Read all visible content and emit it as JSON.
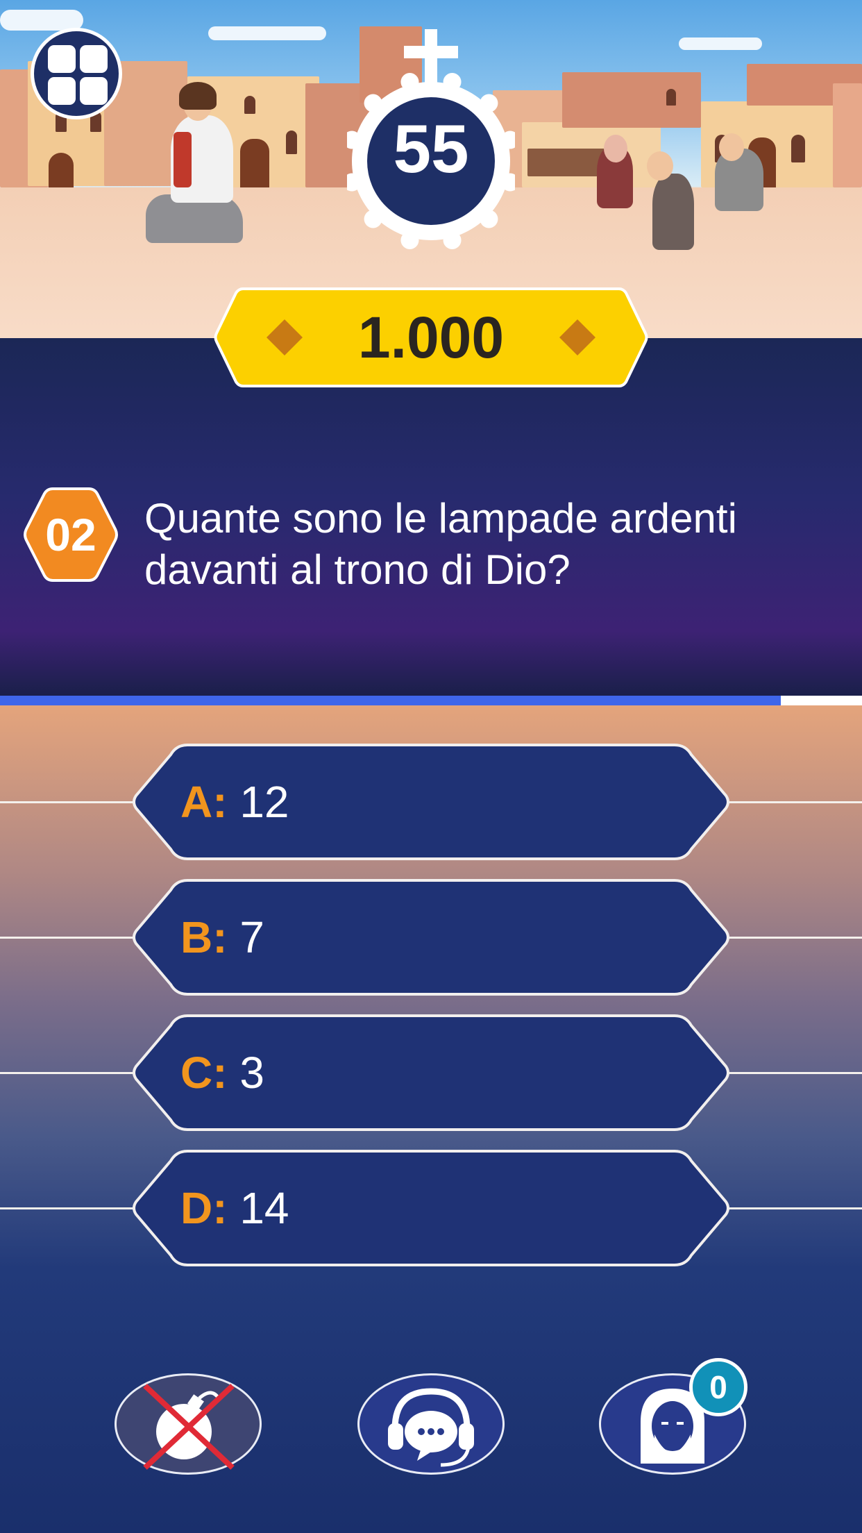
{
  "timer": {
    "seconds": "55"
  },
  "prize": {
    "amount": "1.000"
  },
  "question": {
    "number": "02",
    "text": "Quante sono le lampade ardenti davanti al trono di Dio?"
  },
  "progress": {
    "fraction": 0.906
  },
  "answers": [
    {
      "letter": "A:",
      "text": "12"
    },
    {
      "letter": "B:",
      "text": "7"
    },
    {
      "letter": "C:",
      "text": "3"
    },
    {
      "letter": "D:",
      "text": "14"
    }
  ],
  "lifelines": [
    {
      "icon": "bomb-icon",
      "state": "used"
    },
    {
      "icon": "headset-chat-icon",
      "state": "available"
    },
    {
      "icon": "jesus-face-icon",
      "state": "available",
      "count": "0"
    }
  ],
  "colors": {
    "panel": "#272a6e",
    "answer_fill": "#1f3275",
    "answer_letter": "#f2951e",
    "prize_banner": "#fcd000",
    "question_badge": "#f28a21",
    "progress_fill": "#3f66ea",
    "badge": "#1191b8"
  }
}
